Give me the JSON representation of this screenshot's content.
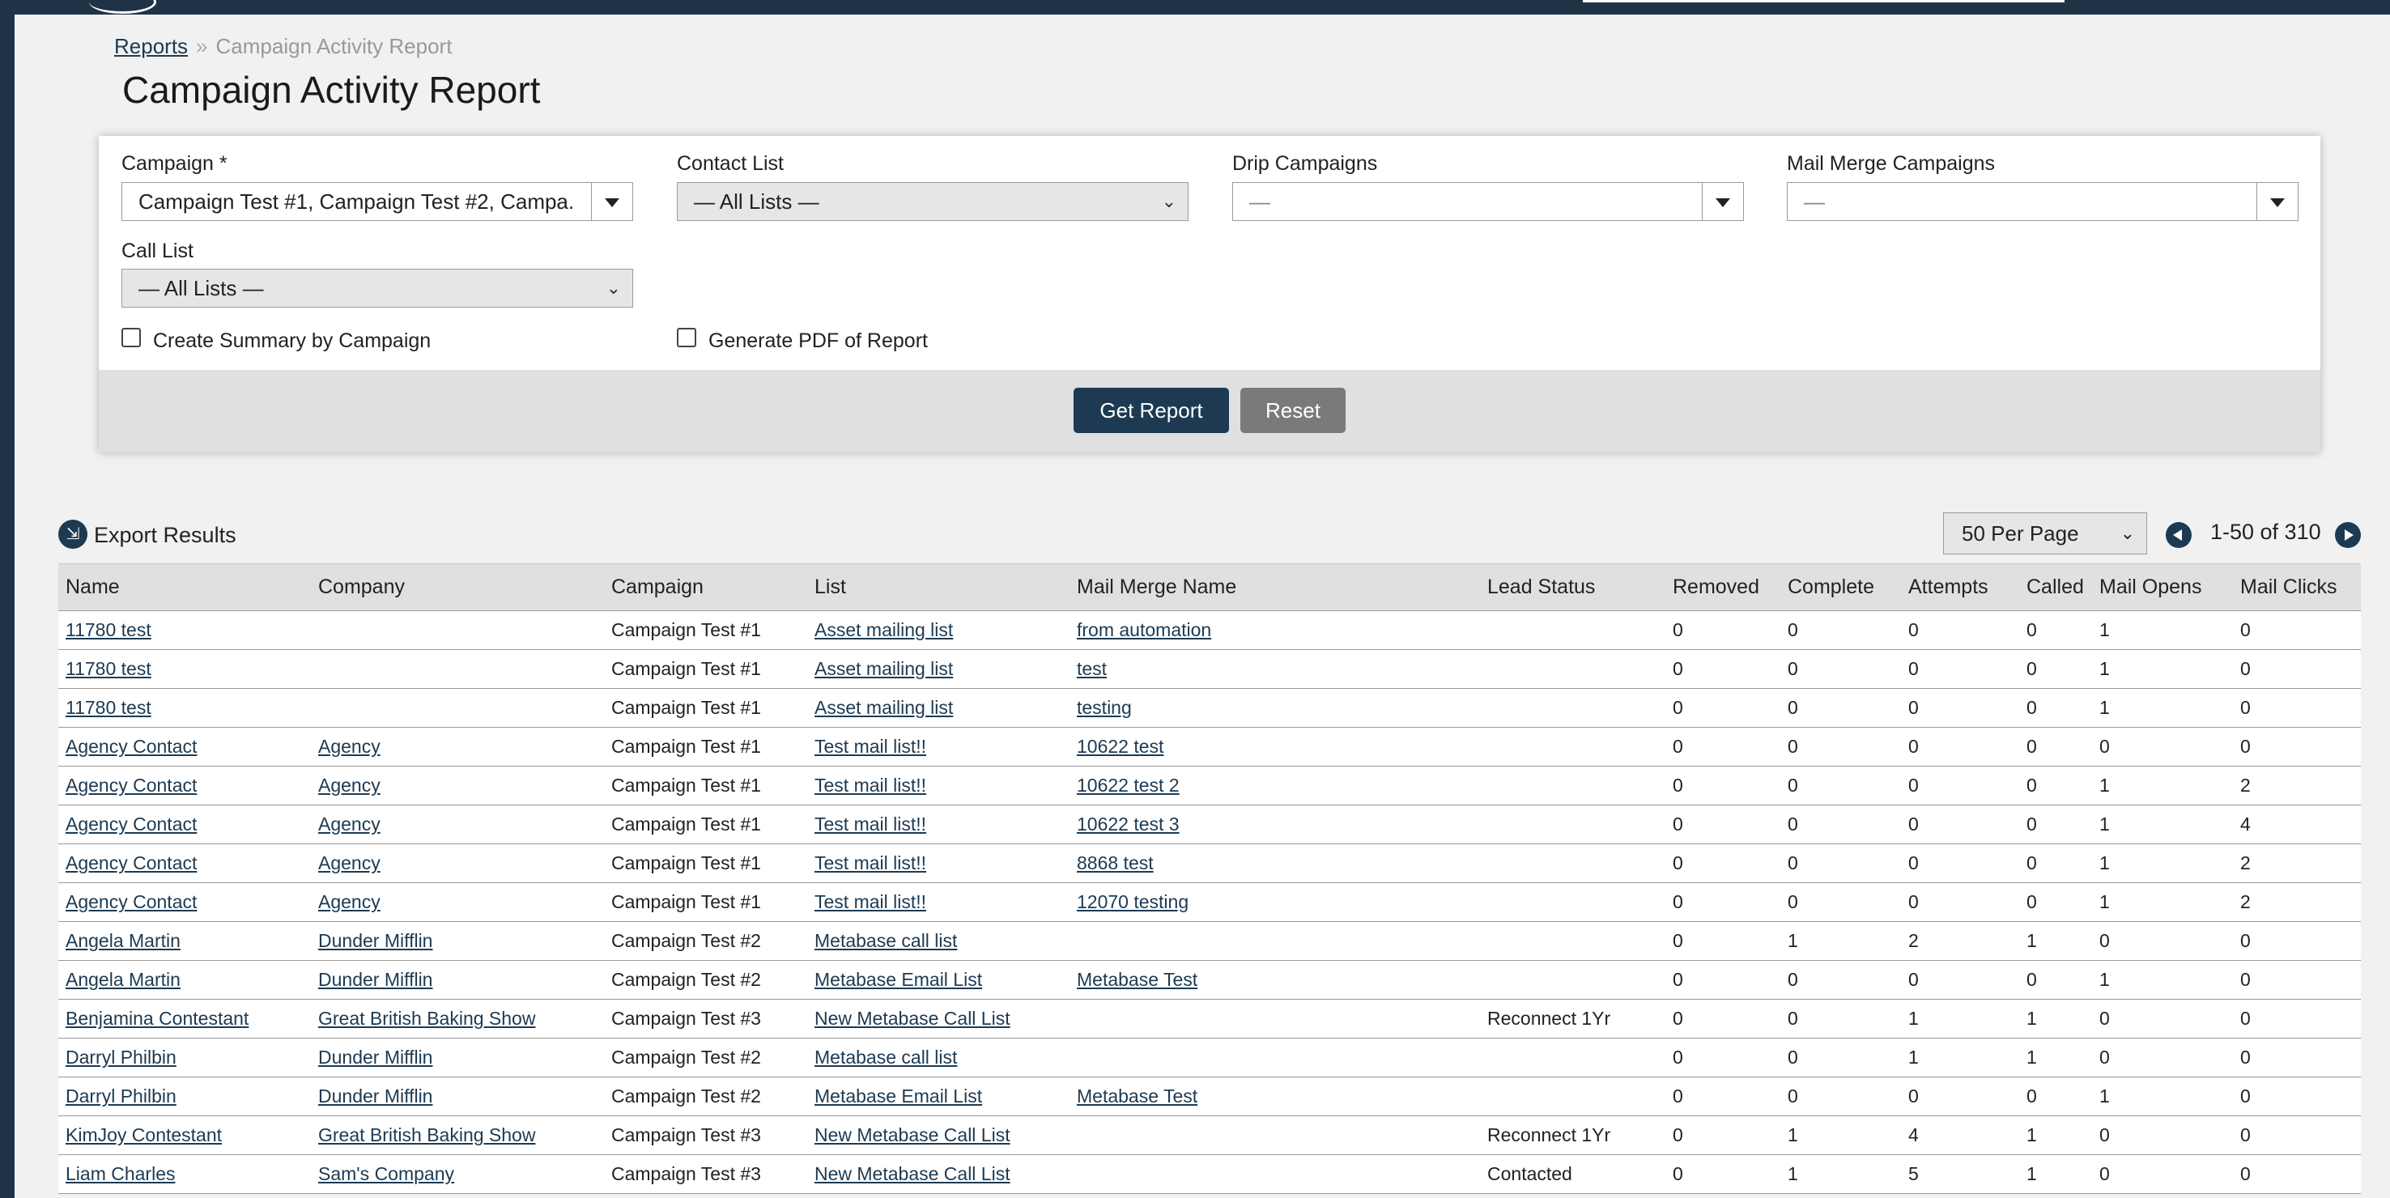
{
  "breadcrumb": {
    "root": "Reports",
    "separator": "»",
    "current": "Campaign Activity Report"
  },
  "page_title": "Campaign Activity Report",
  "filters": {
    "campaign": {
      "label": "Campaign *",
      "value": "Campaign Test #1, Campaign Test #2, Campa..."
    },
    "contact_list": {
      "label": "Contact List",
      "value": "— All Lists —"
    },
    "drip_campaigns": {
      "label": "Drip Campaigns",
      "value": "—"
    },
    "mail_merge_campaigns": {
      "label": "Mail Merge Campaigns",
      "value": "—"
    },
    "call_list": {
      "label": "Call List",
      "value": "— All Lists —"
    },
    "summary_checkbox": {
      "label": "Create Summary by Campaign",
      "checked": false
    },
    "pdf_checkbox": {
      "label": "Generate PDF of Report",
      "checked": false
    }
  },
  "actions": {
    "get_report": "Get Report",
    "reset": "Reset"
  },
  "results": {
    "export_label": "Export Results",
    "per_page": "50 Per Page",
    "pagination": "1-50 of 310",
    "columns": [
      "Name",
      "Company",
      "Campaign",
      "List",
      "Mail Merge Name",
      "Lead Status",
      "Removed",
      "Complete",
      "Attempts",
      "Called",
      "Mail Opens",
      "Mail Clicks"
    ],
    "rows": [
      [
        "11780 test",
        "",
        "Campaign Test #1",
        "Asset mailing list",
        "from automation",
        "",
        "0",
        "0",
        "0",
        "0",
        "1",
        "0"
      ],
      [
        "11780 test",
        "",
        "Campaign Test #1",
        "Asset mailing list",
        "test",
        "",
        "0",
        "0",
        "0",
        "0",
        "1",
        "0"
      ],
      [
        "11780 test",
        "",
        "Campaign Test #1",
        "Asset mailing list",
        "testing",
        "",
        "0",
        "0",
        "0",
        "0",
        "1",
        "0"
      ],
      [
        "Agency Contact",
        "Agency",
        "Campaign Test #1",
        "Test mail list!!",
        "10622 test",
        "",
        "0",
        "0",
        "0",
        "0",
        "0",
        "0"
      ],
      [
        "Agency Contact",
        "Agency",
        "Campaign Test #1",
        "Test mail list!!",
        "10622 test 2",
        "",
        "0",
        "0",
        "0",
        "0",
        "1",
        "2"
      ],
      [
        "Agency Contact",
        "Agency",
        "Campaign Test #1",
        "Test mail list!!",
        "10622 test 3",
        "",
        "0",
        "0",
        "0",
        "0",
        "1",
        "4"
      ],
      [
        "Agency Contact",
        "Agency",
        "Campaign Test #1",
        "Test mail list!!",
        "8868 test",
        "",
        "0",
        "0",
        "0",
        "0",
        "1",
        "2"
      ],
      [
        "Agency Contact",
        "Agency",
        "Campaign Test #1",
        "Test mail list!!",
        "12070 testing",
        "",
        "0",
        "0",
        "0",
        "0",
        "1",
        "2"
      ],
      [
        "Angela Martin",
        "Dunder Mifflin",
        "Campaign Test #2",
        "Metabase call list",
        "",
        "",
        "0",
        "1",
        "2",
        "1",
        "0",
        "0"
      ],
      [
        "Angela Martin",
        "Dunder Mifflin",
        "Campaign Test #2",
        "Metabase Email List",
        "Metabase Test",
        "",
        "0",
        "0",
        "0",
        "0",
        "1",
        "0"
      ],
      [
        "Benjamina Contestant",
        "Great British Baking Show",
        "Campaign Test #3",
        "New Metabase Call List",
        "",
        "Reconnect 1Yr",
        "0",
        "0",
        "1",
        "1",
        "0",
        "0"
      ],
      [
        "Darryl Philbin",
        "Dunder Mifflin",
        "Campaign Test #2",
        "Metabase call list",
        "",
        "",
        "0",
        "0",
        "1",
        "1",
        "0",
        "0"
      ],
      [
        "Darryl Philbin",
        "Dunder Mifflin",
        "Campaign Test #2",
        "Metabase Email List",
        "Metabase Test",
        "",
        "0",
        "0",
        "0",
        "0",
        "1",
        "0"
      ],
      [
        "KimJoy Contestant",
        "Great British Baking Show",
        "Campaign Test #3",
        "New Metabase Call List",
        "",
        "Reconnect 1Yr",
        "0",
        "1",
        "4",
        "1",
        "0",
        "0"
      ],
      [
        "Liam Charles",
        "Sam's Company",
        "Campaign Test #3",
        "New Metabase Call List",
        "",
        "Contacted",
        "0",
        "1",
        "5",
        "1",
        "0",
        "0"
      ]
    ]
  },
  "colors": {
    "primary": "#1d3a52",
    "topbar": "#1e3346",
    "background": "#f1f1f1",
    "secondary_button": "#7a7a7a"
  }
}
